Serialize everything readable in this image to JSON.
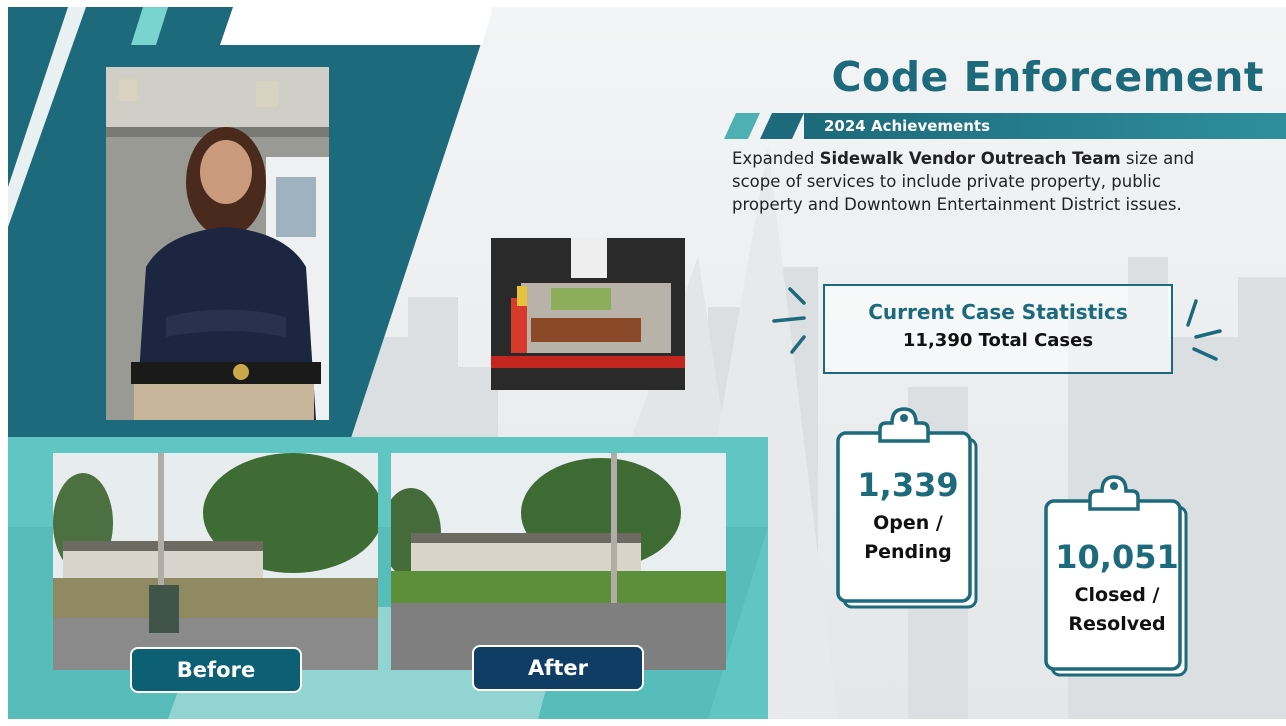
{
  "slide": {
    "title": "Code Enforcement",
    "subtitle": "2024 Achievements",
    "description": {
      "before": "Expanded ",
      "bold": "Sidewalk Vendor Outreach Team",
      "after": " size and scope of services to include private property, public property and Downtown Entertainment District issues."
    }
  },
  "stats": {
    "heading": "Current Case Statistics",
    "total": "11,390 Total Cases",
    "open": {
      "value": "1,339",
      "label_line1": "Open /",
      "label_line2": "Pending"
    },
    "closed": {
      "value": "10,051",
      "label_line1": "Closed /",
      "label_line2": "Resolved"
    }
  },
  "buttons": {
    "before": "Before",
    "after": "After"
  },
  "colors": {
    "teal_dark": "#1c6a7b",
    "teal_light": "#5fc6c3",
    "navy": "#0f3d64"
  },
  "icons": [
    "clipboard-icon",
    "emphasis-lines-icon"
  ]
}
